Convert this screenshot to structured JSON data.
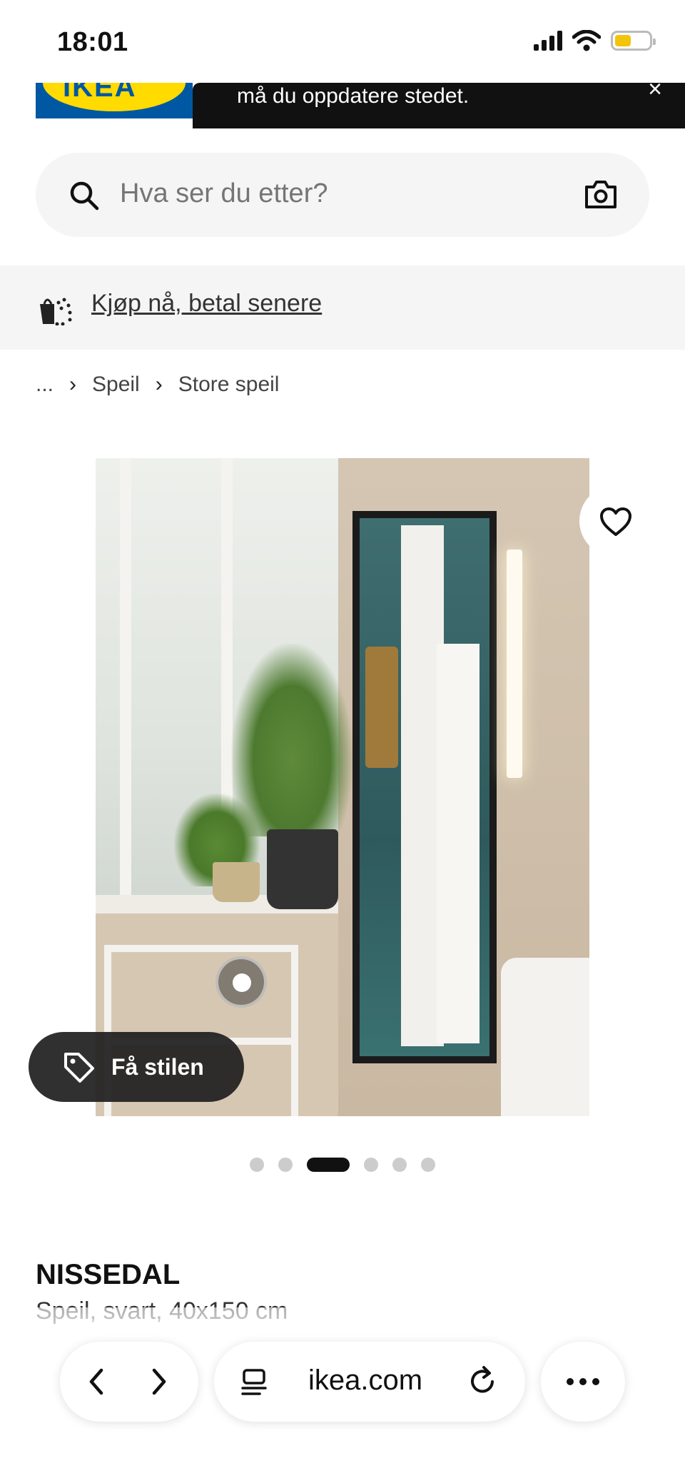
{
  "status_bar": {
    "time": "18:01"
  },
  "header": {
    "logo_text": "IKEA",
    "toast_text": "må du oppdatere stedet.",
    "toast_close": "×"
  },
  "search": {
    "placeholder": "Hva ser du etter?"
  },
  "promo": {
    "link_text": "Kjøp nå, betal senere"
  },
  "breadcrumb": {
    "items": [
      "...",
      "Speil",
      "Store speil"
    ]
  },
  "product": {
    "style_button_label": "Få stilen",
    "carousel": {
      "total": 6,
      "active_index": 2
    },
    "name": "NISSEDAL",
    "description": "Speil, svart, 40x150 cm"
  },
  "browser": {
    "url": "ikea.com"
  },
  "colors": {
    "brand_blue": "#0058a3",
    "brand_yellow": "#ffdb00",
    "battery": "#f2c40c"
  }
}
